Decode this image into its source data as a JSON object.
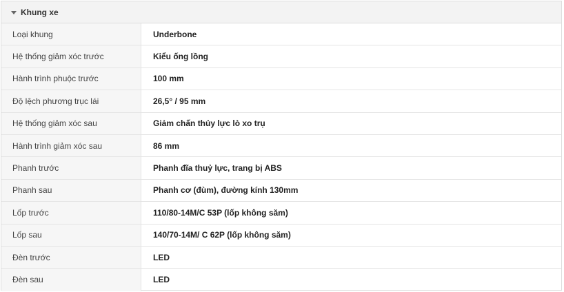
{
  "section": {
    "title": "Khung xe",
    "icon": "caret-down-icon"
  },
  "rows": [
    {
      "label": "Loại khung",
      "value": "Underbone"
    },
    {
      "label": "Hệ thống giảm xóc trước",
      "value": "Kiểu ống lồng"
    },
    {
      "label": "Hành trình phuộc trước",
      "value": "100 mm"
    },
    {
      "label": "Độ lệch phương trục lái",
      "value": "26,5° / 95 mm"
    },
    {
      "label": "Hệ thống giảm xóc sau",
      "value": "Giảm chấn thủy lực lò xo trụ"
    },
    {
      "label": "Hành trình giảm xóc sau",
      "value": "86 mm"
    },
    {
      "label": "Phanh trước",
      "value": "Phanh đĩa thuỷ lực, trang bị ABS"
    },
    {
      "label": "Phanh sau",
      "value": "Phanh cơ (đùm), đường kính 130mm"
    },
    {
      "label": "Lốp trước",
      "value": "110/80-14M/C 53P (lốp không săm)"
    },
    {
      "label": "Lốp sau",
      "value": "140/70-14M/ C 62P (lốp không săm)"
    },
    {
      "label": "Đèn trước",
      "value": "LED"
    },
    {
      "label": "Đèn sau",
      "value": "LED"
    }
  ]
}
